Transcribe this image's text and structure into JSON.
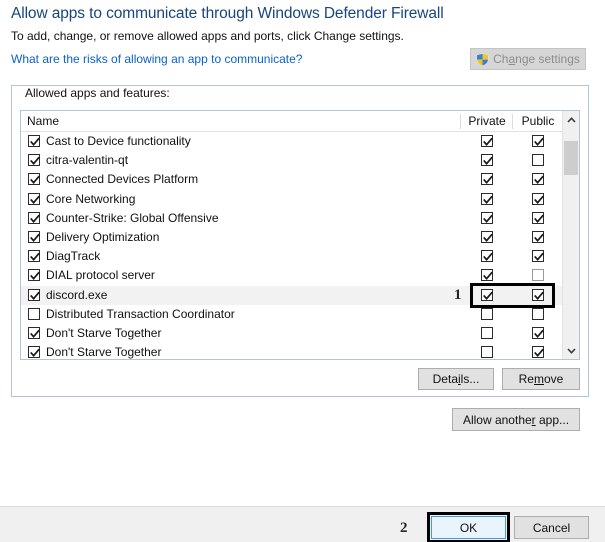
{
  "header": {
    "title": "Allow apps to communicate through Windows Defender Firewall",
    "subtitle": "To add, change, or remove allowed apps and ports, click Change settings.",
    "risk_link": "What are the risks of allowing an app to communicate?",
    "change_settings": {
      "label_before": "Ch",
      "label_accel": "a",
      "label_after": "nge settings",
      "icon": "uac-shield-icon",
      "enabled": false
    }
  },
  "groupbox": {
    "label": "Allowed apps and features:"
  },
  "list": {
    "columns": {
      "name": "Name",
      "private": "Private",
      "public": "Public"
    },
    "rows": [
      {
        "name": "Cast to Device functionality",
        "enabled": true,
        "private": true,
        "public": true,
        "public_gray": false,
        "selected": false
      },
      {
        "name": "citra-valentin-qt",
        "enabled": true,
        "private": true,
        "public": false,
        "public_gray": false,
        "selected": false
      },
      {
        "name": "Connected Devices Platform",
        "enabled": true,
        "private": true,
        "public": true,
        "public_gray": false,
        "selected": false
      },
      {
        "name": "Core Networking",
        "enabled": true,
        "private": true,
        "public": true,
        "public_gray": false,
        "selected": false
      },
      {
        "name": "Counter-Strike: Global Offensive",
        "enabled": true,
        "private": true,
        "public": true,
        "public_gray": false,
        "selected": false
      },
      {
        "name": "Delivery Optimization",
        "enabled": true,
        "private": true,
        "public": true,
        "public_gray": false,
        "selected": false
      },
      {
        "name": "DiagTrack",
        "enabled": true,
        "private": true,
        "public": true,
        "public_gray": false,
        "selected": false
      },
      {
        "name": "DIAL protocol server",
        "enabled": true,
        "private": true,
        "public": false,
        "public_gray": true,
        "selected": false
      },
      {
        "name": "discord.exe",
        "enabled": true,
        "private": true,
        "public": true,
        "public_gray": false,
        "selected": true
      },
      {
        "name": "Distributed Transaction Coordinator",
        "enabled": false,
        "private": false,
        "public": false,
        "public_gray": false,
        "selected": false
      },
      {
        "name": "Don't Starve Together",
        "enabled": true,
        "private": false,
        "public": true,
        "public_gray": false,
        "selected": false
      },
      {
        "name": "Don't Starve Together",
        "enabled": true,
        "private": false,
        "public": true,
        "public_gray": false,
        "selected": false
      }
    ],
    "scrollbar": {
      "up_icon": "chevron-up-icon",
      "down_icon": "chevron-down-icon"
    }
  },
  "buttons": {
    "details_before": "Deta",
    "details_accel": "i",
    "details_after": "ls...",
    "remove_before": "Re",
    "remove_accel": "m",
    "remove_after": "ove",
    "allow_before": "Allow anothe",
    "allow_accel": "r",
    "allow_after": " app...",
    "ok": "OK",
    "cancel": "Cancel"
  },
  "annotations": {
    "step1": "1",
    "step2": "2"
  },
  "colors": {
    "title": "#17457e",
    "link": "#0a62c8",
    "focus_border": "#3a9fe0",
    "annotation": "#000000"
  }
}
